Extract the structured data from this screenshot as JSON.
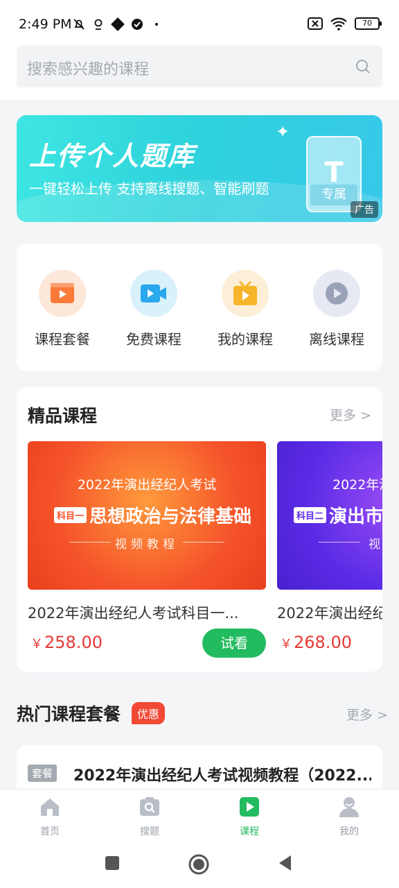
{
  "status_bar": {
    "time": "2:49 PM",
    "battery": "70"
  },
  "search": {
    "placeholder": "搜索感兴趣的课程"
  },
  "banner": {
    "title": "上传个人题库",
    "subtitle": "一键轻松上传 支持离线搜题、智能刷题",
    "doc_letter": "T",
    "doc_label": "专属",
    "ad_label": "广告"
  },
  "quick_entries": [
    {
      "label": "课程套餐",
      "icon": "package-icon",
      "color": "#fb7a3a",
      "bg": "#fde7d8"
    },
    {
      "label": "免费课程",
      "icon": "video-camera-icon",
      "color": "#2aa8ee",
      "bg": "#d9f1fb"
    },
    {
      "label": "我的课程",
      "icon": "tv-play-icon",
      "color": "#f6b52a",
      "bg": "#fdeed7"
    },
    {
      "label": "离线课程",
      "icon": "offline-play-icon",
      "color": "#9aa2b8",
      "bg": "#e6e9f2"
    }
  ],
  "featured": {
    "title": "精品课程",
    "more": "更多 >",
    "cards": [
      {
        "year_line": "2022年演出经纪人考试",
        "tag": "科目一",
        "subject": "思想政治与法律基础",
        "video_label": "视频教程",
        "title": "2022年演出经纪人考试科目一...",
        "currency": "￥",
        "price": "258.00",
        "trial": "试看",
        "colors": [
          "#f5532a",
          "#f98b1c"
        ]
      },
      {
        "year_line": "2022年演",
        "tag": "科目二",
        "subject": "演出市场",
        "video_label": "视",
        "title": "2022年演出经纪",
        "currency": "￥",
        "price": "268.00",
        "colors": [
          "#5a2be6",
          "#8a3ef0"
        ]
      }
    ]
  },
  "hot": {
    "title": "热门课程套餐",
    "badge": "优惠",
    "more": "更多 >",
    "item": {
      "tag": "套餐",
      "title": "2022年演出经纪人考试视频教程（2022..."
    }
  },
  "tabbar": {
    "items": [
      {
        "label": "首页",
        "icon": "home-icon",
        "active": false
      },
      {
        "label": "搜题",
        "icon": "camera-search-icon",
        "active": false
      },
      {
        "label": "课程",
        "icon": "course-play-icon",
        "active": true
      },
      {
        "label": "我的",
        "icon": "profile-icon",
        "active": false
      }
    ]
  }
}
